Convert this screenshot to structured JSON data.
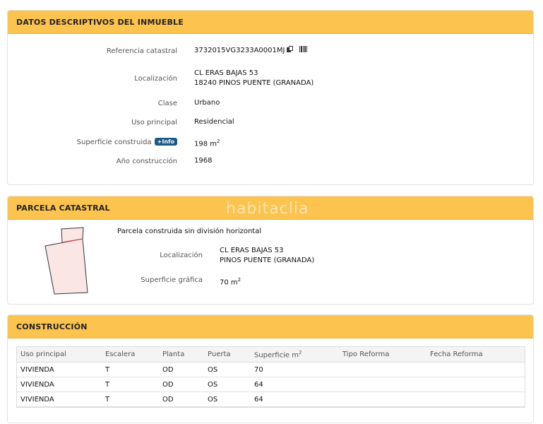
{
  "descriptivos": {
    "title": "DATOS DESCRIPTIVOS DEL INMUEBLE",
    "ref_label": "Referencia catastral",
    "ref_value": "3732015VG3233A0001MJ",
    "loc_label": "Localización",
    "loc_line1": "CL ERAS BAJAS 53",
    "loc_line2": "18240 PINOS PUENTE (GRANADA)",
    "clase_label": "Clase",
    "clase_value": "Urbano",
    "uso_label": "Uso principal",
    "uso_value": "Residencial",
    "sup_label": "Superficie construida",
    "info_badge": "+Info",
    "sup_value": "198 m",
    "sup_unit_exp": "2",
    "anio_label": "Año construcción",
    "anio_value": "1968"
  },
  "watermark": "habitaclia",
  "parcela": {
    "title": "PARCELA CATASTRAL",
    "tipo": "Parcela construida sin división horizontal",
    "loc_label": "Localización",
    "loc_line1": "CL ERAS BAJAS 53",
    "loc_line2": "PINOS PUENTE (GRANADA)",
    "sup_label": "Superficie gráfica",
    "sup_value": "70 m",
    "sup_unit_exp": "2"
  },
  "construccion": {
    "title": "CONSTRUCCIÓN",
    "headers": [
      "Uso principal",
      "Escalera",
      "Planta",
      "Puerta",
      "Superficie m",
      "Tipo Reforma",
      "Fecha Reforma"
    ],
    "sup_header_exp": "2",
    "rows": [
      [
        "VIVIENDA",
        "T",
        "OD",
        "OS",
        "70",
        "",
        ""
      ],
      [
        "VIVIENDA",
        "T",
        "OD",
        "OS",
        "64",
        "",
        ""
      ],
      [
        "VIVIENDA",
        "T",
        "OD",
        "OS",
        "64",
        "",
        ""
      ]
    ]
  }
}
